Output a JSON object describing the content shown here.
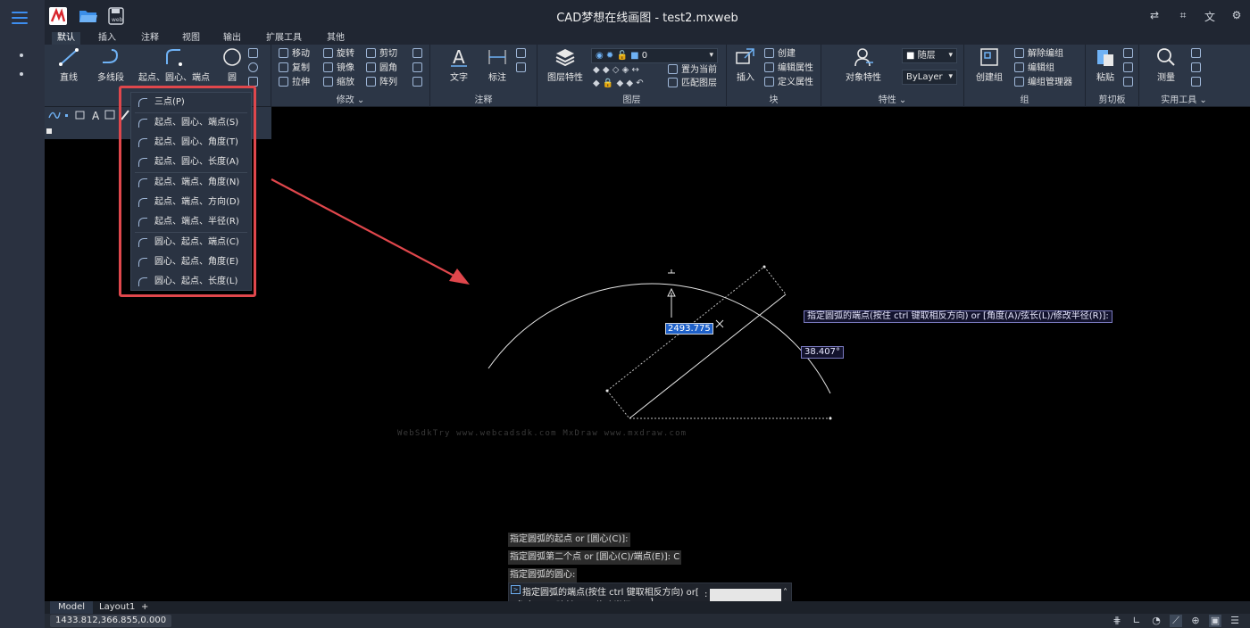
{
  "app": {
    "title": "CAD梦想在线画图 - test2.mxweb",
    "logo_text": "web"
  },
  "ribbon": {
    "tabs": [
      "默认",
      "插入",
      "注释",
      "视图",
      "输出",
      "扩展工具",
      "其他"
    ],
    "draw": {
      "line": "直线",
      "polyline": "多线段",
      "arc": "起点、圆心、端点",
      "circle": "圆"
    },
    "modify": {
      "label": "修改 ⌄",
      "move": "移动",
      "copy": "复制",
      "stretch": "拉伸",
      "rotate": "旋转",
      "mirror": "镜像",
      "scale": "缩放",
      "trim": "剪切",
      "fillet": "圆角",
      "array": "阵列"
    },
    "annotation": {
      "label": "注释",
      "text": "文字",
      "dimension": "标注"
    },
    "layers": {
      "label": "图层",
      "properties": "图层特性",
      "layer_value": "0",
      "set_current": "置为当前",
      "match_layer": "匹配图层"
    },
    "block": {
      "label": "块",
      "insert": "插入",
      "create": "创建",
      "edit_attr": "编辑属性",
      "define_attr": "定义属性"
    },
    "properties": {
      "label": "特性 ⌄",
      "object_props": "对象特性",
      "color_value": "随层",
      "linetype_value": "ByLayer"
    },
    "groups": {
      "label": "组",
      "create_group": "创建组",
      "ungroup": "解除编组",
      "edit_group": "编辑组",
      "group_manager": "编组管理器"
    },
    "clipboard": {
      "label": "剪切板",
      "paste": "粘贴"
    },
    "utilities": {
      "label": "实用工具 ⌄",
      "measure": "测量"
    }
  },
  "arc_menu": {
    "items": [
      "三点(P)",
      "起点、圆心、端点(S)",
      "起点、圆心、角度(T)",
      "起点、圆心、长度(A)",
      "起点、端点、角度(N)",
      "起点、端点、方向(D)",
      "起点、端点、半径(R)",
      "圆心、起点、端点(C)",
      "圆心、起点、角度(E)",
      "圆心、起点、长度(L)"
    ]
  },
  "canvas": {
    "tooltip": "指定圆弧的端点(按住 ctrl 键取相反方向) or [角度(A)/弦长(L)/修改半径(R)]:",
    "length_input": "2493.775",
    "angle_label": "38.407°",
    "watermark": "WebSdkTry www.webcadsdk.com MxDraw www.mxdraw.com"
  },
  "command": {
    "history": [
      "指定圆弧的起点 or [圆心(C)]:",
      "指定圆弧第二个点 or [圆心(C)/端点(E)]: C",
      "指定圆弧的圆心:"
    ],
    "current_prompt": "指定圆弧的端点(按住 ctrl 键取相反方向) or[",
    "options": [
      "角度(A)",
      "弦长(L)",
      "修改半径(R)"
    ],
    "options_close": "]",
    "colon": ":",
    "input_value": ""
  },
  "layout_tabs": [
    "Model",
    "Layout1"
  ],
  "add_layout": "+",
  "status": {
    "coords": "1433.812,366.855,0.000"
  },
  "colors": {
    "accent": "#3d8ef0",
    "highlight_box": "#e0474c"
  }
}
